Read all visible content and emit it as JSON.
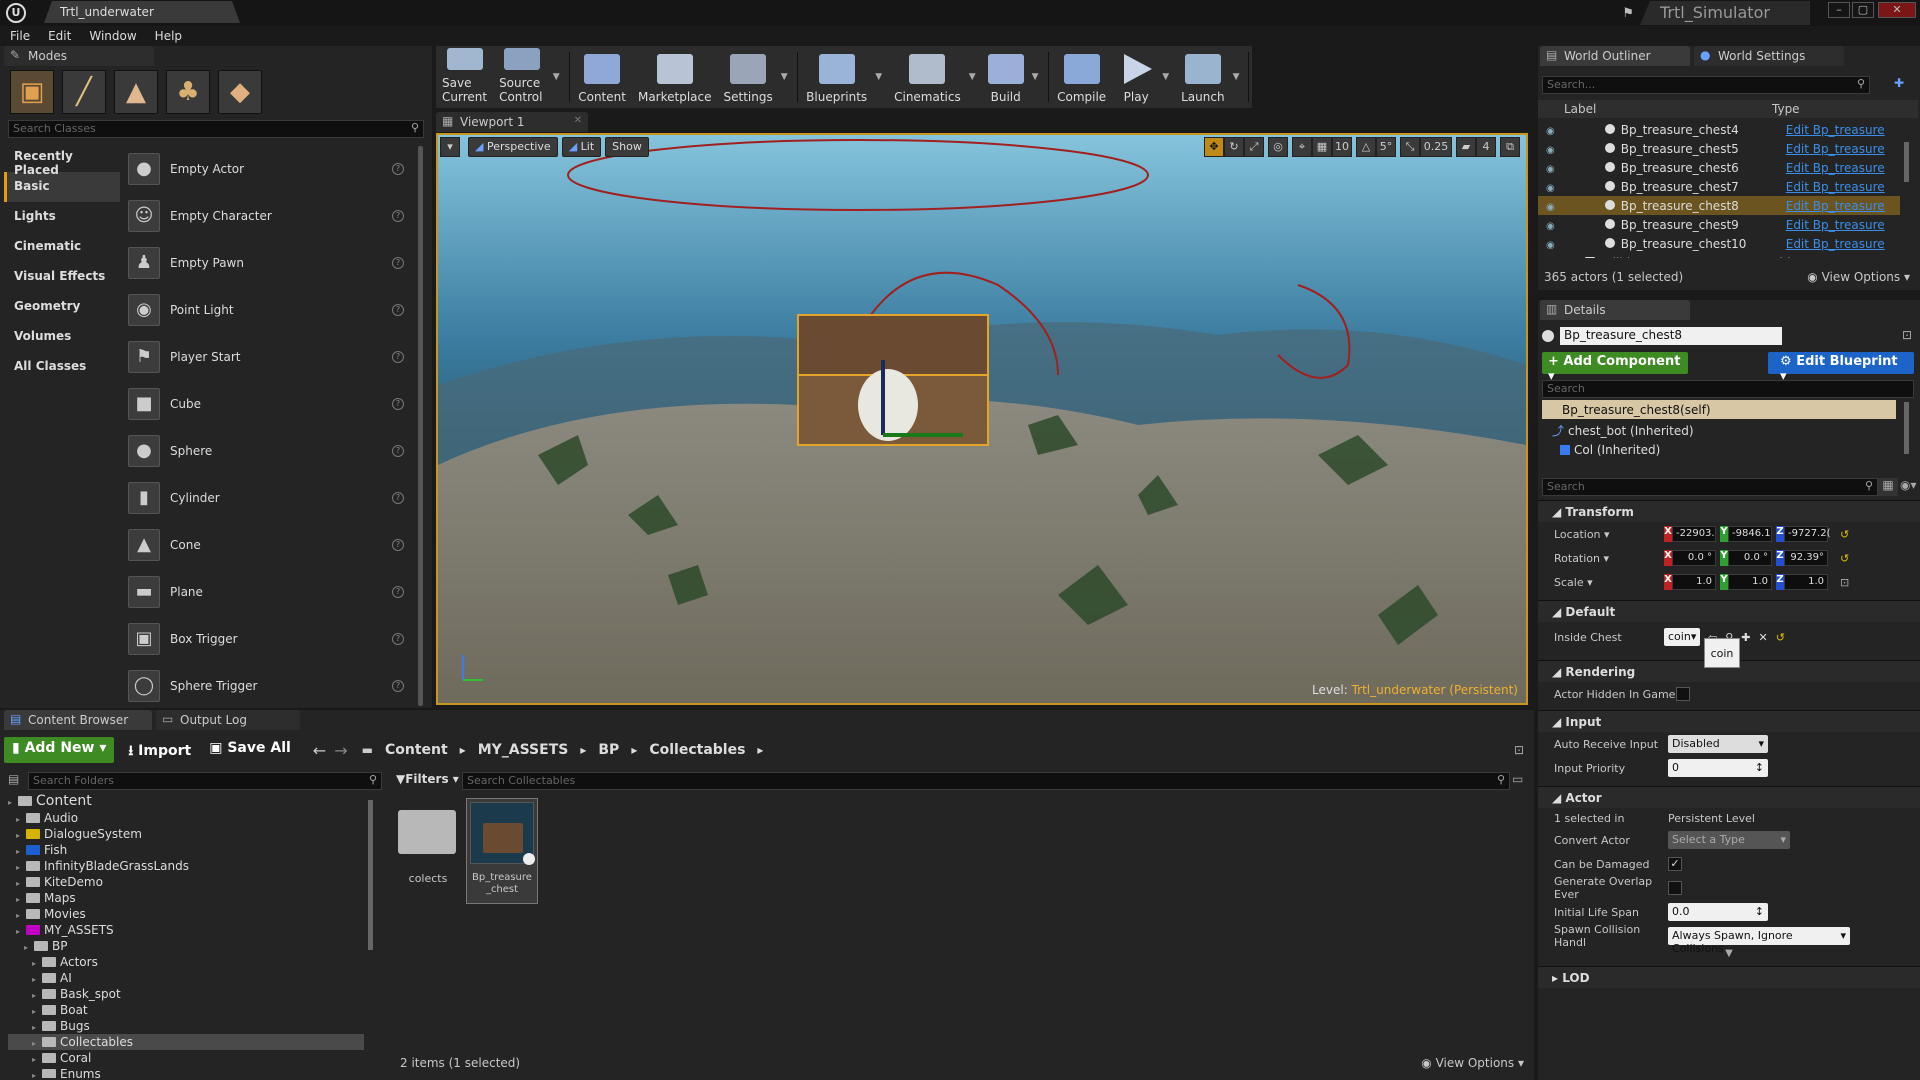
{
  "window": {
    "doc_tab": "Trtl_underwater",
    "project_title": "Trtl_Simulator"
  },
  "menu": [
    "File",
    "Edit",
    "Window",
    "Help"
  ],
  "modes": {
    "tab": "Modes",
    "search_placeholder": "Search Classes",
    "categories": [
      "Recently Placed",
      "Basic",
      "Lights",
      "Cinematic",
      "Visual Effects",
      "Geometry",
      "Volumes",
      "All Classes"
    ],
    "selected_category": "Basic",
    "actors": [
      "Empty Actor",
      "Empty Character",
      "Empty Pawn",
      "Point Light",
      "Player Start",
      "Cube",
      "Sphere",
      "Cylinder",
      "Cone",
      "Plane",
      "Box Trigger",
      "Sphere Trigger"
    ]
  },
  "toolbar": [
    {
      "label": "Save Current",
      "icon": "save-icon",
      "drop": false
    },
    {
      "label": "Source Control",
      "icon": "source-control-icon",
      "drop": true
    },
    {
      "label": "Content",
      "icon": "content-icon",
      "drop": false
    },
    {
      "label": "Marketplace",
      "icon": "marketplace-icon",
      "drop": false
    },
    {
      "label": "Settings",
      "icon": "settings-icon",
      "drop": true
    },
    {
      "label": "Blueprints",
      "icon": "blueprints-icon",
      "drop": true
    },
    {
      "label": "Cinematics",
      "icon": "cinematics-icon",
      "drop": true
    },
    {
      "label": "Build",
      "icon": "build-icon",
      "drop": true
    },
    {
      "label": "Compile",
      "icon": "compile-icon",
      "drop": false
    },
    {
      "label": "Play",
      "icon": "play-icon",
      "drop": true
    },
    {
      "label": "Launch",
      "icon": "launch-icon",
      "drop": true
    }
  ],
  "viewport": {
    "tab": "Viewport 1",
    "perspective": "Perspective",
    "lit": "Lit",
    "show": "Show",
    "grid": "10",
    "angle": "5°",
    "scale": "0.25",
    "camera_speed": "4",
    "level_prefix": "Level:",
    "level_name": "Trtl_underwater (Persistent)"
  },
  "outliner": {
    "tab1": "World Outliner",
    "tab2": "World Settings",
    "search_placeholder": "Search...",
    "col_label": "Label",
    "col_type": "Type",
    "rows": [
      {
        "label": "Bp_treasure_chest4",
        "type": "Edit Bp_treasure",
        "selected": false
      },
      {
        "label": "Bp_treasure_chest5",
        "type": "Edit Bp_treasure",
        "selected": false
      },
      {
        "label": "Bp_treasure_chest6",
        "type": "Edit Bp_treasure",
        "selected": false
      },
      {
        "label": "Bp_treasure_chest7",
        "type": "Edit Bp_treasure",
        "selected": false
      },
      {
        "label": "Bp_treasure_chest8",
        "type": "Edit Bp_treasure",
        "selected": true
      },
      {
        "label": "Bp_treasure_chest9",
        "type": "Edit Bp_treasure",
        "selected": false
      },
      {
        "label": "Bp_treasure_chest10",
        "type": "Edit Bp_treasure",
        "selected": false
      },
      {
        "label": "Edibles",
        "type": "Folder",
        "selected": false
      }
    ],
    "count": "365 actors (1 selected)",
    "view_options": "View Options"
  },
  "details": {
    "tab": "Details",
    "name": "Bp_treasure_chest8",
    "add_component": "+ Add Component",
    "edit_blueprint": "Edit Blueprint",
    "search_placeholder": "Search",
    "components": [
      "Bp_treasure_chest8(self)",
      "chest_bot (Inherited)",
      "Col (Inherited)"
    ],
    "transform": {
      "title": "Transform",
      "location_label": "Location",
      "rotation_label": "Rotation",
      "scale_label": "Scale",
      "location": [
        "-22903.",
        "-9846.1",
        "-9727.2("
      ],
      "rotation": [
        "0.0 °",
        "0.0 °",
        "92.39°"
      ],
      "scale": [
        "1.0",
        "1.0",
        "1.0"
      ]
    },
    "default": {
      "title": "Default",
      "inside_chest_label": "Inside Chest",
      "inside_chest_value": "coin",
      "tooltip": "coin"
    },
    "rendering": {
      "title": "Rendering",
      "actor_hidden_label": "Actor Hidden In Game"
    },
    "input": {
      "title": "Input",
      "auto_receive_label": "Auto Receive Input",
      "auto_receive_value": "Disabled",
      "priority_label": "Input Priority",
      "priority_value": "0"
    },
    "actor": {
      "title": "Actor",
      "selected_in_label": "1 selected in",
      "selected_in_value": "Persistent Level",
      "convert_label": "Convert Actor",
      "convert_value": "Select a Type",
      "damaged_label": "Can be Damaged",
      "damaged_checked": true,
      "overlap_label": "Generate Overlap Ever",
      "overlap_checked": false,
      "lifespan_label": "Initial Life Span",
      "lifespan_value": "0.0",
      "spawn_label": "Spawn Collision Handl",
      "spawn_value": "Always Spawn, Ignore Collisions"
    },
    "lod": {
      "title": "LOD"
    }
  },
  "content_browser": {
    "tab1": "Content Browser",
    "tab2": "Output Log",
    "add_new": "Add New",
    "import": "Import",
    "save_all": "Save All",
    "breadcrumbs": [
      "Content",
      "MY_ASSETS",
      "BP",
      "Collectables"
    ],
    "folder_search": "Search Folders",
    "filters": "Filters",
    "asset_search": "Search Collectables",
    "tree": [
      {
        "label": "Content",
        "indent": 0,
        "color": "#b8b8b8",
        "root": true
      },
      {
        "label": "Audio",
        "indent": 1,
        "color": "#b8b8b8"
      },
      {
        "label": "DialogueSystem",
        "indent": 1,
        "color": "#d4b400"
      },
      {
        "label": "Fish",
        "indent": 1,
        "color": "#1e5fd0"
      },
      {
        "label": "InfinityBladeGrassLands",
        "indent": 1,
        "color": "#b8b8b8"
      },
      {
        "label": "KiteDemo",
        "indent": 1,
        "color": "#b8b8b8"
      },
      {
        "label": "Maps",
        "indent": 1,
        "color": "#b8b8b8"
      },
      {
        "label": "Movies",
        "indent": 1,
        "color": "#b8b8b8"
      },
      {
        "label": "MY_ASSETS",
        "indent": 1,
        "color": "#c000c0"
      },
      {
        "label": "BP",
        "indent": 2,
        "color": "#b8b8b8"
      },
      {
        "label": "Actors",
        "indent": 3,
        "color": "#b8b8b8"
      },
      {
        "label": "AI",
        "indent": 3,
        "color": "#b8b8b8"
      },
      {
        "label": "Bask_spot",
        "indent": 3,
        "color": "#b8b8b8"
      },
      {
        "label": "Boat",
        "indent": 3,
        "color": "#b8b8b8"
      },
      {
        "label": "Bugs",
        "indent": 3,
        "color": "#b8b8b8"
      },
      {
        "label": "Collectables",
        "indent": 3,
        "color": "#b8b8b8",
        "selected": true
      },
      {
        "label": "Coral",
        "indent": 3,
        "color": "#b8b8b8"
      },
      {
        "label": "Enums",
        "indent": 3,
        "color": "#b8b8b8"
      }
    ],
    "assets": [
      {
        "label": "colects",
        "kind": "folder"
      },
      {
        "label": "Bp_treasure_chest",
        "kind": "blueprint",
        "selected": true
      }
    ],
    "status": "2 items (1 selected)",
    "view_options": "View Options"
  }
}
